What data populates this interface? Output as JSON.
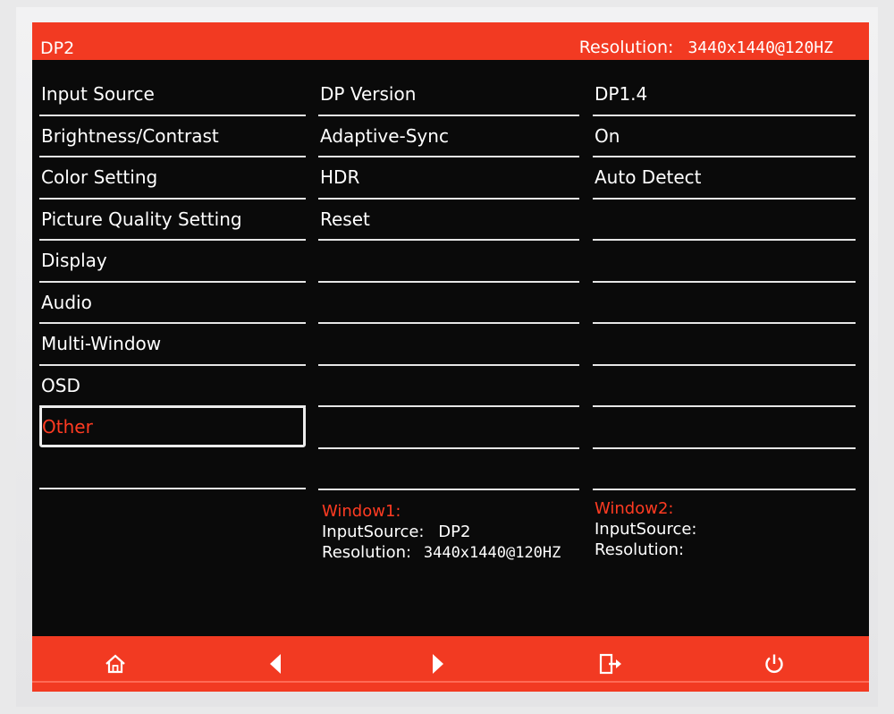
{
  "header": {
    "input_source": "DP2",
    "resolution_label": "Resolution:",
    "resolution_value": "3440x1440@120HZ"
  },
  "menu": {
    "items": [
      "Input Source",
      "Brightness/Contrast",
      "Color Setting",
      "Picture Quality Setting",
      "Display",
      "Audio",
      "Multi-Window",
      "OSD",
      "Other",
      ""
    ],
    "selected": "Other"
  },
  "submenu": {
    "items": [
      "DP Version",
      "Adaptive-Sync",
      "HDR",
      "Reset",
      "",
      "",
      "",
      "",
      "",
      ""
    ]
  },
  "values": {
    "items": [
      "DP1.4",
      "On",
      "Auto Detect",
      "",
      "",
      "",
      "",
      "",
      "",
      ""
    ]
  },
  "window1": {
    "title": "Window1:",
    "input_label": "InputSource:",
    "input_value": "DP2",
    "resolution_label": "Resolution:",
    "resolution_value": "3440x1440@120HZ"
  },
  "window2": {
    "title": "Window2:",
    "input_label": "InputSource:",
    "resolution_label": "Resolution:"
  },
  "footer": {
    "buttons": [
      "home-icon",
      "arrow-left-icon",
      "arrow-right-icon",
      "exit-icon",
      "power-icon"
    ]
  },
  "colors": {
    "accent": "#f23a22",
    "background": "#0a0a0a",
    "text": "#ffffff",
    "highlight_text": "#ff3b22"
  }
}
